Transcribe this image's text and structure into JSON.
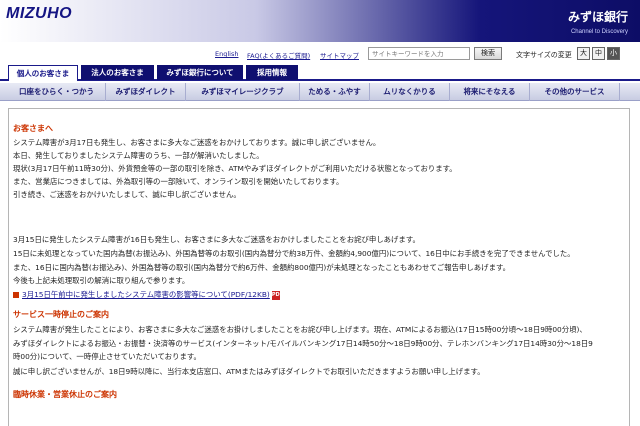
{
  "header": {
    "logo": "MIZUHO",
    "bank_name": "みずほ銀行",
    "tagline": "Channel to Discovery"
  },
  "utility": {
    "links": [
      "English",
      "FAQ(よくあるご質問)",
      "サイトマップ"
    ],
    "search_placeholder": "サイトキーワードを入力",
    "search_button": "検索",
    "font_size_label": "文字サイズの変更",
    "font_sizes": [
      "大",
      "中",
      "小"
    ]
  },
  "tabs": [
    "個人のお客さま",
    "法人のお客さま",
    "みずほ銀行について",
    "採用情報"
  ],
  "nav": [
    "口座をひらく・つかう",
    "みずほダイレクト",
    "みずほマイレージクラブ",
    "ためる・ふやす",
    "ムリなくかりる",
    "将来にそなえる",
    "その他のサービス"
  ],
  "notice": {
    "heading": "お客さまへ",
    "lines": [
      "システム障害が3月17日も発生し、お客さまに多大なご迷惑をおかけしております。誠に申し訳ございません。",
      "本日、発生しておりましたシステム障害のうち、一部が解消いたしました。",
      "現状(3月17日午前11時30分)、外貨預金等の一部の取引を除き、ATMやみずほダイレクトがご利用いただける状態となっております。",
      "また、営業店につきましては、外為取引等の一部除いて、オンライン取引を開始いたしております。",
      "引き続き、ご迷惑をおかけいたしまして、誠に申し訳ございません。"
    ],
    "lines2": [
      "3月15日に発生したシステム障害が16日も発生し、お客さまに多大なご迷惑をおかけしましたことをお詫び申しあげます。",
      "15日に未処理となっていた国内為替(お振込み)、外国為替等のお取引(国内為替分で約38万件、金額約4,900億円)について、16日中にお手続きを完了できませんでした。",
      "また、16日に国内為替(お振込み)、外国為替等の取引(国内為替分で約6万件、金額約800億円)が未処理となったこともあわせてご報告申しあげます。",
      "今後も上記未処理取引の解消に取り組んで参ります。"
    ],
    "link": "3月15日午前中に発生しましたシステム障害の影響等について(PDF/12KB)",
    "pdf_label": "PDF"
  },
  "suspension": {
    "heading": "サービス一時停止のご案内",
    "lines": [
      "システム障害が発生したことにより、お客さまに多大なご迷惑をお掛けしましたことをお詫び申し上げます。現在、ATMによるお振込(17日15時00分頃〜18日9時00分頃)、",
      "みずほダイレクトによるお振込・お振替・決済等のサービス(インターネット/モバイルバンキング17日14時50分〜18日9時00分、テレホンバンキング17日14時30分〜18日9",
      "時00分)について、一時停止させていただいております。",
      "誠に申し訳ございませんが、18日9時以降に、当行本支店窓口、ATMまたはみずほダイレクトでお取引いただきますようお願い申し上げます。"
    ]
  },
  "next_heading": "臨時休業・営業休止のご案内"
}
